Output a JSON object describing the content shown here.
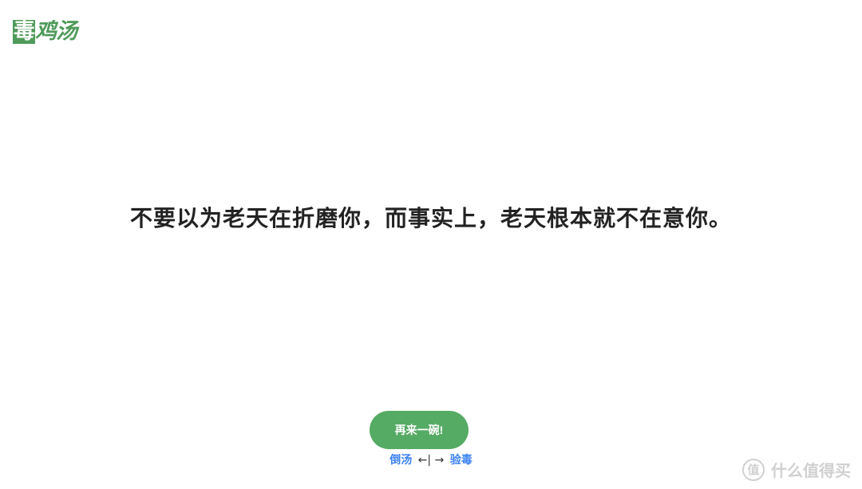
{
  "logo": {
    "first": "毒",
    "rest": "鸡汤"
  },
  "quote": {
    "text": "不要以为老天在折磨你，而事实上，老天根本就不在意你。"
  },
  "actions": {
    "again_label": "再来一碗!"
  },
  "hint": {
    "prev_label": "倒汤",
    "keys": "←| →",
    "next_label": "验毒"
  },
  "watermark": {
    "mark": "值",
    "text": "什么值得买"
  },
  "colors": {
    "accent": "#56ab64",
    "link": "#3b82f6",
    "text": "#222222"
  }
}
